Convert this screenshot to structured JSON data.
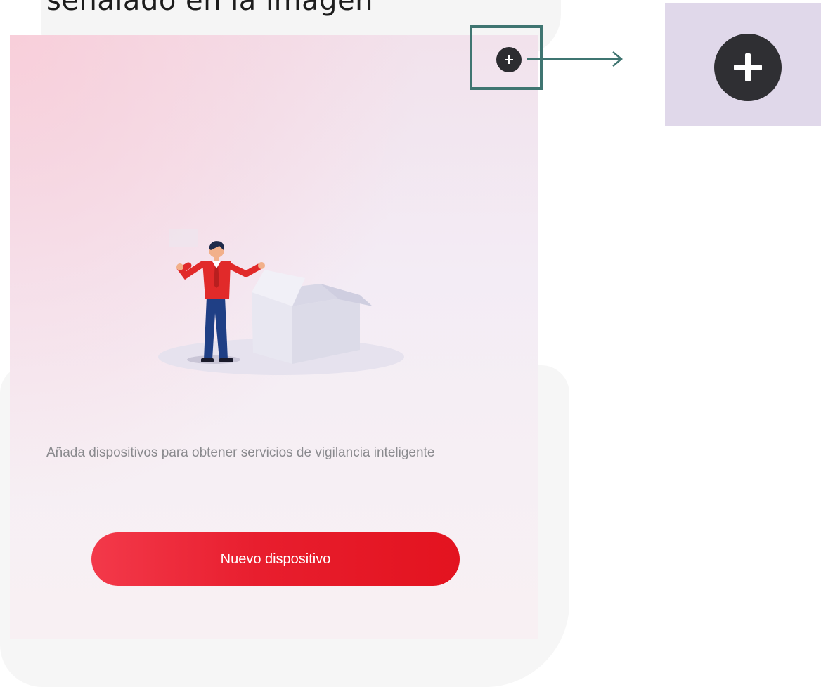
{
  "header": {
    "title": "señalado en la imagen"
  },
  "toolbar": {
    "add_icon": "plus-icon"
  },
  "zoom": {
    "add_icon": "plus-icon"
  },
  "empty_state": {
    "illustration": "empty-box-illustration",
    "description": "Añada dispositivos para obtener servicios de vigilancia inteligente",
    "button_label": "Nuevo dispositivo"
  },
  "colors": {
    "accent_red": "#e3131f",
    "highlight": "#3f7571",
    "dark_button": "#2c2c30",
    "zoom_background": "#e0d8ea"
  }
}
